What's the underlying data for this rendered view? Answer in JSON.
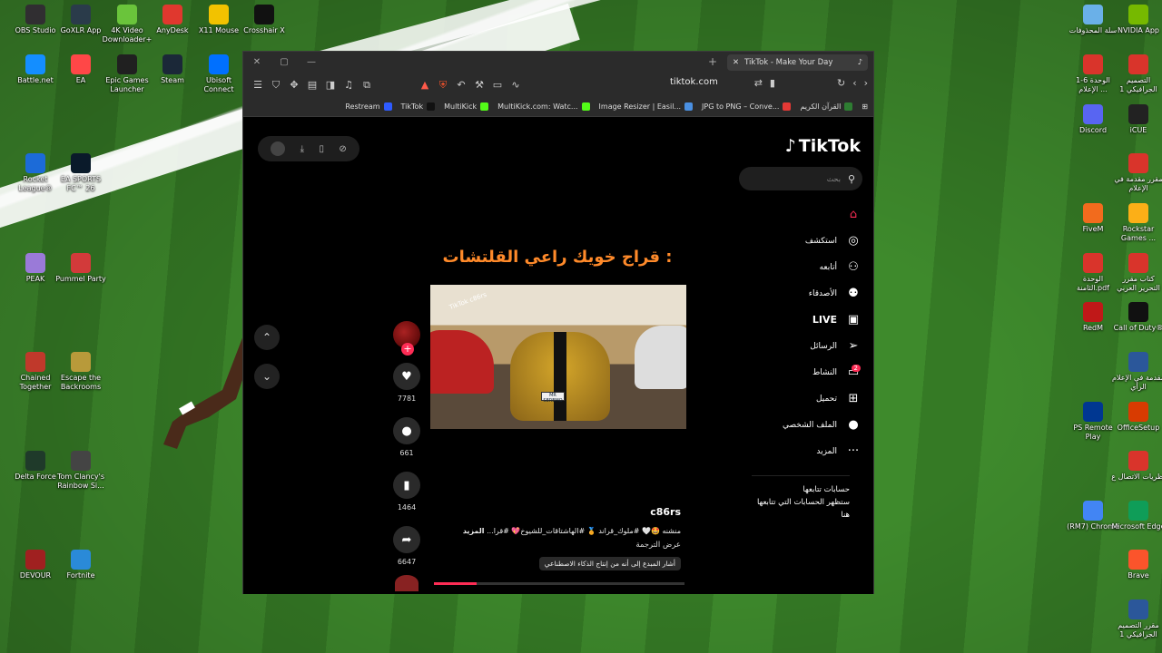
{
  "desktop": {
    "left_icons": [
      {
        "label": "OBS Studio",
        "color": "#302e31"
      },
      {
        "label": "GoXLR App",
        "color": "#2a3b4a"
      },
      {
        "label": "4K Video Downloader+",
        "color": "#6ac43b"
      },
      {
        "label": "AnyDesk",
        "color": "#e0382e"
      },
      {
        "label": "X11 Mouse",
        "color": "#f2c200"
      },
      {
        "label": "Crosshair X",
        "color": "#111111"
      },
      {
        "label": "Battle.net",
        "color": "#148eff"
      },
      {
        "label": "EA",
        "color": "#ff4747"
      },
      {
        "label": "Epic Games Launcher",
        "color": "#202020"
      },
      {
        "label": "Steam",
        "color": "#1b2838"
      },
      {
        "label": "Ubisoft Connect",
        "color": "#0070ff"
      },
      {
        "label": "Rocket League®",
        "color": "#1c6bd8"
      },
      {
        "label": "EA SPORTS FC™ 26",
        "color": "#0a1a2a"
      },
      {
        "label": "PEAK",
        "color": "#9a7ad8"
      },
      {
        "label": "Pummel Party",
        "color": "#d23a3a"
      },
      {
        "label": "Chained Together",
        "color": "#c0392b"
      },
      {
        "label": "Escape the Backrooms",
        "color": "#b89a3a"
      },
      {
        "label": "Delta Force",
        "color": "#1f3a2a"
      },
      {
        "label": "Tom Clancy's Rainbow Si...",
        "color": "#444444"
      },
      {
        "label": "DEVOUR",
        "color": "#a02020"
      },
      {
        "label": "Fortnite",
        "color": "#2a8ad8"
      }
    ],
    "right_icons": [
      {
        "label": "سلة المحذوفات",
        "color": "#6ab0e8"
      },
      {
        "label": "NVIDIA App",
        "color": "#76b900"
      },
      {
        "label": "الوحدة 6-1 الإعلام ...",
        "color": "#d9342b"
      },
      {
        "label": "التصميم الجرافيكي 1",
        "color": "#d9342b"
      },
      {
        "label": "Discord",
        "color": "#5865f2"
      },
      {
        "label": "iCUE",
        "color": "#222222"
      },
      {
        "label": "مقرر مقدمة في الإعلام",
        "color": "#d9342b"
      },
      {
        "label": "FiveM",
        "color": "#f26b1d"
      },
      {
        "label": "Rockstar Games ...",
        "color": "#fcaf17"
      },
      {
        "label": "الوحدة الثامنة.pdf",
        "color": "#d9342b"
      },
      {
        "label": "كتاب مقرر التحرير العربي",
        "color": "#d9342b"
      },
      {
        "label": "RedM",
        "color": "#c01818"
      },
      {
        "label": "Call of Duty®",
        "color": "#111111"
      },
      {
        "label": "مقدمة في الإعلام الرأي",
        "color": "#2b579a"
      },
      {
        "label": "PS Remote Play",
        "color": "#003791"
      },
      {
        "label": "OfficeSetup",
        "color": "#d83b01"
      },
      {
        "label": "نظريات الاتصال ع",
        "color": "#d9342b"
      },
      {
        "label": "(RM7) Chrome",
        "color": "#4285f4"
      },
      {
        "label": "Microsoft Edge",
        "color": "#0f9d58"
      },
      {
        "label": "Brave",
        "color": "#fb542b"
      },
      {
        "label": "مقرر التصميم الجرافيكي 1",
        "color": "#2b579a"
      }
    ]
  },
  "browser": {
    "tab_title": "TikTok - Make Your Day",
    "url": "tiktok.com",
    "bookmarks": [
      {
        "label": "Restream",
        "color": "#2e5bff"
      },
      {
        "label": "TikTok",
        "color": "#111111"
      },
      {
        "label": "MultiKick",
        "color": "#53fc18"
      },
      {
        "label": "MultiKick.com: Watc...",
        "color": "#53fc18"
      },
      {
        "label": "Image Resizer | Easil...",
        "color": "#4a90e2"
      },
      {
        "label": "JPG to PNG – Conve...",
        "color": "#e53935"
      },
      {
        "label": "القرآن الكريم",
        "color": "#2e7d32"
      }
    ]
  },
  "tiktok": {
    "logo": "TikTok",
    "search_placeholder": "بحث",
    "nav": [
      {
        "label": "",
        "icon": "home-icon",
        "glyph": "⌂"
      },
      {
        "label": "استكشف",
        "icon": "explore-icon",
        "glyph": "◎"
      },
      {
        "label": "أتابعه",
        "icon": "following-icon",
        "glyph": "⚇"
      },
      {
        "label": "الأصدقاء",
        "icon": "friends-icon",
        "glyph": "⚉"
      },
      {
        "label": "LIVE",
        "icon": "live-icon",
        "glyph": "▣"
      },
      {
        "label": "الرسائل",
        "icon": "messages-icon",
        "glyph": "➢"
      },
      {
        "label": "النشاط",
        "icon": "activity-icon",
        "glyph": "▭",
        "badge": "2"
      },
      {
        "label": "تحميل",
        "icon": "upload-icon",
        "glyph": "⊞"
      },
      {
        "label": "الملف الشخصي",
        "icon": "profile-icon",
        "glyph": "●"
      },
      {
        "label": "المزيد",
        "icon": "more-icon",
        "glyph": "···"
      }
    ],
    "following_title": "حسابات تتابعها",
    "following_hint": "ستظهر الحسابات التي تتابعها هنا",
    "video_caption_overlay": "قراج خويك راعي القلتشات :",
    "video_watermark": "TikTok c86rs",
    "plate_text": "MR SEREMO",
    "likes": "7781",
    "comments": "661",
    "saves": "1464",
    "shares": "6647",
    "username": "c86rs",
    "description": "منشنه 🤩🤍 #ملوك_قراند 🏅 #الهاشتاقات_للشيوخ💖 #قرا...",
    "more_label": "المزيد",
    "translate_label": "عرض الترجمة",
    "ai_label": "أشار المبدع إلى أنه من إنتاج الذكاء الاصطناعي",
    "progress": 0.17
  }
}
